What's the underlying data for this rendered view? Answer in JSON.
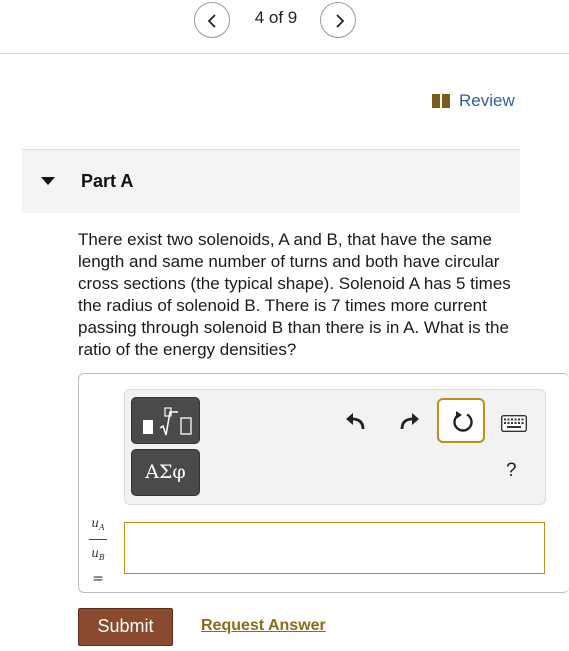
{
  "pager": {
    "text": "4 of 9"
  },
  "review": {
    "label": "Review"
  },
  "part": {
    "title": "Part A"
  },
  "question": {
    "text": "There exist two solenoids, A and B, that have the same length and same number of turns and both have circular cross sections (the typical shape). Solenoid A has 5 times the radius of solenoid B. There is 7 times more current passing through solenoid B than there is in A. What is the ratio of the energy densities?"
  },
  "toolbar": {
    "greek_label": "ΑΣφ",
    "help_label": "?",
    "icons": [
      "template-icon",
      "undo-icon",
      "redo-icon",
      "reset-icon",
      "keyboard-icon"
    ]
  },
  "answer": {
    "numerator": "u",
    "numerator_sub": "A",
    "denominator": "u",
    "denominator_sub": "B",
    "equals": "=",
    "value": ""
  },
  "actions": {
    "submit_label": "Submit",
    "request_label": "Request Answer"
  },
  "colors": {
    "link": "#2b5fa8",
    "accent": "#b8911a",
    "submit": "#8a4a30",
    "request": "#8a6d17"
  }
}
